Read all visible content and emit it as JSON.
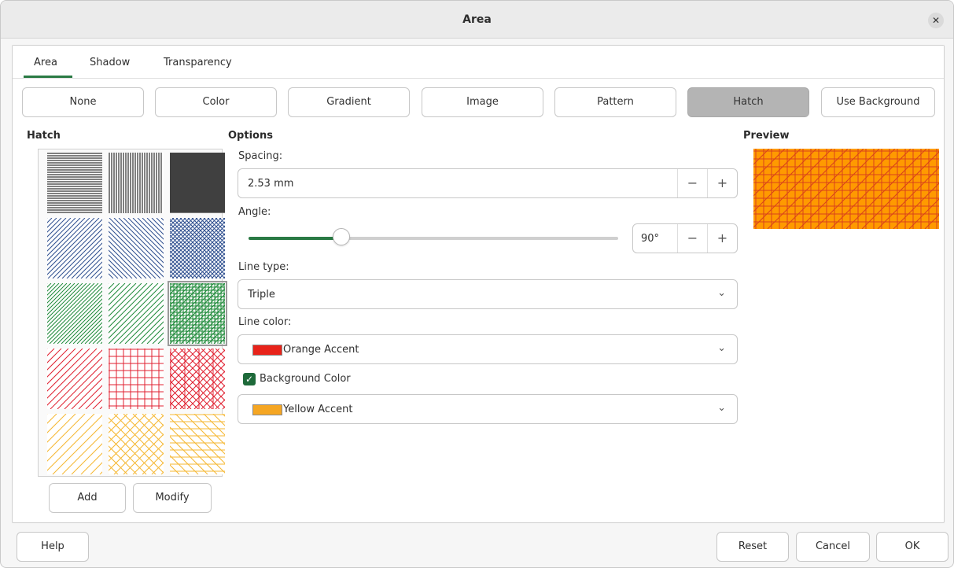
{
  "window": {
    "title": "Area",
    "close_icon": "close-icon"
  },
  "tabs": [
    {
      "label": "Area",
      "active": true
    },
    {
      "label": "Shadow",
      "active": false
    },
    {
      "label": "Transparency",
      "active": false
    }
  ],
  "fill_types": [
    {
      "label": "None",
      "active": false
    },
    {
      "label": "Color",
      "active": false
    },
    {
      "label": "Gradient",
      "active": false
    },
    {
      "label": "Image",
      "active": false
    },
    {
      "label": "Pattern",
      "active": false
    },
    {
      "label": "Hatch",
      "active": true
    },
    {
      "label": "Use Background",
      "active": false
    }
  ],
  "hatch": {
    "title": "Hatch",
    "selected_index": 8,
    "swatch_colors": [
      "#000000",
      "#000000",
      "#000000",
      "#2f4f8f",
      "#2f4f8f",
      "#2f4f8f",
      "#1f8a3a",
      "#1f8a3a",
      "#1f8a3a",
      "#e02030",
      "#e02030",
      "#e02030",
      "#f5b732",
      "#f5b732",
      "#f5b732"
    ],
    "add_label": "Add",
    "modify_label": "Modify"
  },
  "options": {
    "title": "Options",
    "spacing_label": "Spacing:",
    "spacing_value": "2.53 mm",
    "angle_label": "Angle:",
    "angle_value": "90°",
    "angle_fraction": 0.25,
    "line_type_label": "Line type:",
    "line_type_value": "Triple",
    "line_color_label": "Line color:",
    "line_color_name": "Orange Accent",
    "line_color_hex": "#e8231a",
    "background_color_label": "Background Color",
    "background_color_checked": true,
    "background_color_name": "Yellow Accent",
    "background_color_hex": "#f5a623",
    "minus": "−",
    "plus": "+",
    "chevron": "⌄"
  },
  "preview": {
    "title": "Preview",
    "fill": "#ff9a00",
    "line": "#d8411c"
  },
  "footer": {
    "help": "Help",
    "reset": "Reset",
    "cancel": "Cancel",
    "ok": "OK"
  }
}
